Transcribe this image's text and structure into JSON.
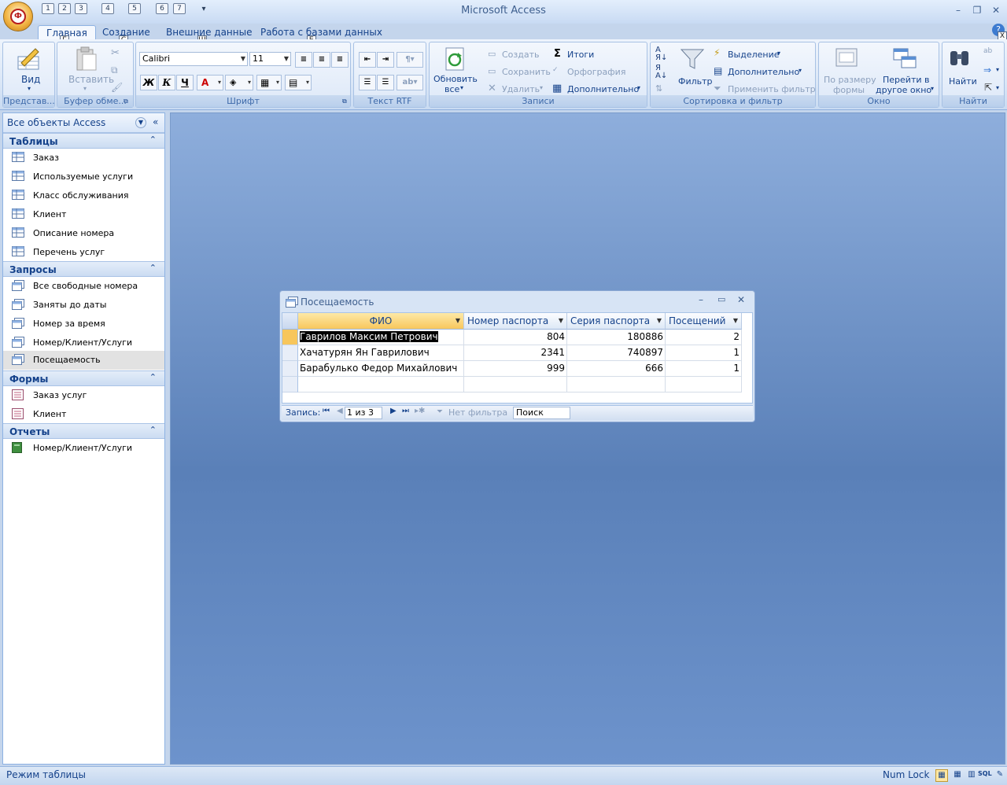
{
  "window": {
    "title": "Microsoft Access",
    "office_button_glyph": "Ф"
  },
  "qat": {
    "keytips": [
      "1",
      "2",
      "3",
      "4",
      "5",
      "6",
      "7"
    ]
  },
  "help_keytip": "Х",
  "ribbon_tabs": [
    {
      "label": "Главная",
      "keytip": "Г"
    },
    {
      "label": "Создание",
      "keytip": "С"
    },
    {
      "label": "Внешние данные",
      "keytip": "Ш"
    },
    {
      "label": "Работа с базами данных",
      "keytip": "Б"
    }
  ],
  "ribbon": {
    "views": {
      "label": "Представ...",
      "view_button": "Вид"
    },
    "clipboard": {
      "label": "Буфер обме...",
      "paste": "Вставить"
    },
    "font": {
      "label": "Шрифт",
      "font_name": "Calibri",
      "font_size": "11",
      "bold": "Ж",
      "italic": "К",
      "underline": "Ч",
      "font_color_glyph": "A"
    },
    "rtf": {
      "label": "Текст RTF"
    },
    "records": {
      "label": "Записи",
      "refresh_line1": "Обновить",
      "refresh_line2": "все",
      "new": "Создать",
      "save": "Сохранить",
      "delete": "Удалить",
      "totals": "Итоги",
      "spelling": "Орфография",
      "more": "Дополнительно"
    },
    "sort_filter": {
      "label": "Сортировка и фильтр",
      "filter": "Фильтр",
      "selection": "Выделение",
      "advanced": "Дополнительно",
      "toggle": "Применить фильтр"
    },
    "window": {
      "label": "Окно",
      "fit_line1": "По размеру",
      "fit_line2": "формы",
      "switch_line1": "Перейти в",
      "switch_line2": "другое окно"
    },
    "find": {
      "label": "Найти",
      "find": "Найти"
    }
  },
  "nav": {
    "title": "Все объекты Access",
    "groups": [
      {
        "title": "Таблицы",
        "items": [
          "Заказ",
          "Используемые услуги",
          "Класс обслуживания",
          "Клиент",
          "Описание номера",
          "Перечень услуг"
        ]
      },
      {
        "title": "Запросы",
        "items": [
          "Все свободные номера",
          "Заняты до даты",
          "Номер за время",
          "Номер/Клиент/Услуги",
          "Посещаемость"
        ]
      },
      {
        "title": "Формы",
        "items": [
          "Заказ услуг",
          "Клиент"
        ]
      },
      {
        "title": "Отчеты",
        "items": [
          "Номер/Клиент/Услуги"
        ]
      }
    ],
    "selected_item": "Посещаемость"
  },
  "query_window": {
    "title": "Посещаемость",
    "columns": [
      "ФИО",
      "Номер паспорта",
      "Серия паспорта",
      "Посещений"
    ],
    "rows": [
      [
        "Гаврилов Максим Петрович",
        "804",
        "180886",
        "2"
      ],
      [
        "Хачатурян Ян Гаврилович",
        "2341",
        "740897",
        "1"
      ],
      [
        "Барабулько Федор Михайлович",
        "999",
        "666",
        "1"
      ]
    ],
    "record_nav": {
      "label": "Запись:",
      "position": "1 из 3",
      "no_filter": "Нет фильтра",
      "search": "Поиск"
    }
  },
  "status": {
    "mode": "Режим таблицы",
    "numlock": "Num Lock",
    "sql": "SQL"
  },
  "colors": {
    "accent": "#15428b",
    "ribbon_bg": "#dbe7f7",
    "workspace": "#6a8fc8",
    "active_header": "#f8c75c"
  }
}
